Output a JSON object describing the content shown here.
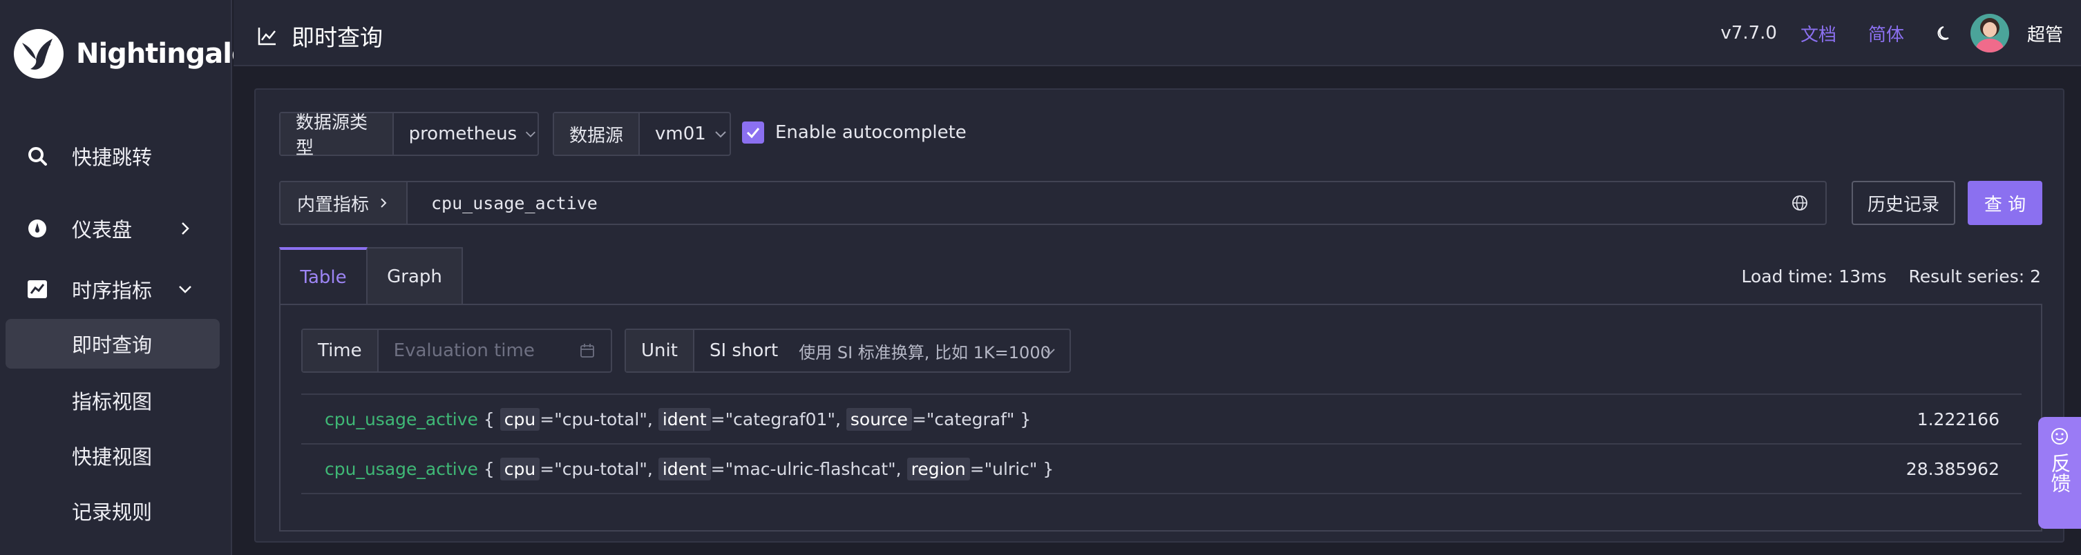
{
  "brand": {
    "name": "Nightingale"
  },
  "sidebar": {
    "items": [
      {
        "label": "快捷跳转",
        "icon": "search-icon"
      },
      {
        "label": "仪表盘",
        "icon": "dashboard-icon"
      },
      {
        "label": "时序指标",
        "icon": "line-chart-icon"
      },
      {
        "label": "即时查询"
      },
      {
        "label": "指标视图"
      },
      {
        "label": "快捷视图"
      },
      {
        "label": "记录规则"
      }
    ]
  },
  "header": {
    "title": "即时查询",
    "version": "v7.7.0",
    "docs": "文档",
    "lang": "简体",
    "user": "超管"
  },
  "query": {
    "datasource_type_label": "数据源类型",
    "datasource_type_value": "prometheus",
    "datasource_label": "数据源",
    "datasource_value": "vm01",
    "autocomplete_label": "Enable autocomplete",
    "autocomplete_checked": true,
    "builtin_metrics_label": "内置指标",
    "promql": "cpu_usage_active",
    "history_button": "历史记录",
    "query_button": "查 询"
  },
  "tabs": [
    {
      "label": "Table"
    },
    {
      "label": "Graph"
    }
  ],
  "stats": {
    "load_time": "Load time: 13ms",
    "result_series": "Result series: 2"
  },
  "table_controls": {
    "time_label": "Time",
    "time_placeholder": "Evaluation time",
    "unit_label": "Unit",
    "unit_value": "SI short",
    "unit_desc": "使用 SI 标准换算, 比如 1K=1000"
  },
  "results": [
    {
      "metric": "cpu_usage_active",
      "labels": [
        {
          "k": "cpu",
          "v": "\"cpu-total\""
        },
        {
          "k": "ident",
          "v": "\"categraf01\""
        },
        {
          "k": "source",
          "v": "\"categraf\""
        }
      ],
      "value": "1.222166"
    },
    {
      "metric": "cpu_usage_active",
      "labels": [
        {
          "k": "cpu",
          "v": "\"cpu-total\""
        },
        {
          "k": "ident",
          "v": "\"mac-ulric-flashcat\""
        },
        {
          "k": "region",
          "v": "\"ulric\""
        }
      ],
      "value": "28.385962"
    }
  ],
  "feedback": {
    "label": "反馈"
  },
  "colors": {
    "accent": "#8b70f0",
    "metric": "#3fb876",
    "sidebar_bg": "#262836",
    "page_bg": "#1e1f2a"
  }
}
